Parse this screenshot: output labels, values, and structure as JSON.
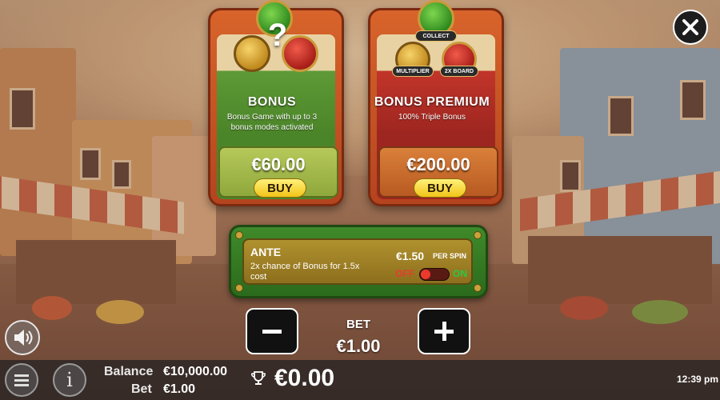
{
  "cards": {
    "bonus": {
      "title": "BONUS",
      "description": "Bonus Game with up to 3 bonus modes activated",
      "price": "€60.00",
      "buy_label": "BUY"
    },
    "premium": {
      "title": "BONUS PREMIUM",
      "description": "100% Triple Bonus",
      "price": "€200.00",
      "buy_label": "BUY",
      "badges": {
        "collect": "COLLECT",
        "multiplier": "MULTIPLIER",
        "board": "2X BOARD"
      }
    },
    "question_mark": "?"
  },
  "ante": {
    "title": "ANTE",
    "description": "2x chance of Bonus for 1.5x cost",
    "price": "€1.50",
    "per_spin": "PER SPIN",
    "toggle_off": "OFF",
    "toggle_on": "ON",
    "enabled": false
  },
  "bet": {
    "label": "BET",
    "value": "€1.00",
    "minus_icon": "minus-icon",
    "plus_icon": "plus-icon"
  },
  "footer": {
    "balance_label": "Balance",
    "balance_value": "€10,000.00",
    "bet_label": "Bet",
    "bet_value": "€1.00",
    "win_value": "€0.00",
    "info_glyph": "i",
    "time": "12:39 pm"
  },
  "icons": {
    "close": "close-icon",
    "sound": "speaker-icon",
    "menu": "menu-icon",
    "info": "info-icon",
    "trophy": "trophy-icon"
  },
  "colors": {
    "buy_button": "#f2c419",
    "toggle_off": "#e53b2f",
    "toggle_on": "#28c846",
    "bonus_card": "#4b8529",
    "premium_card": "#9e2620"
  }
}
